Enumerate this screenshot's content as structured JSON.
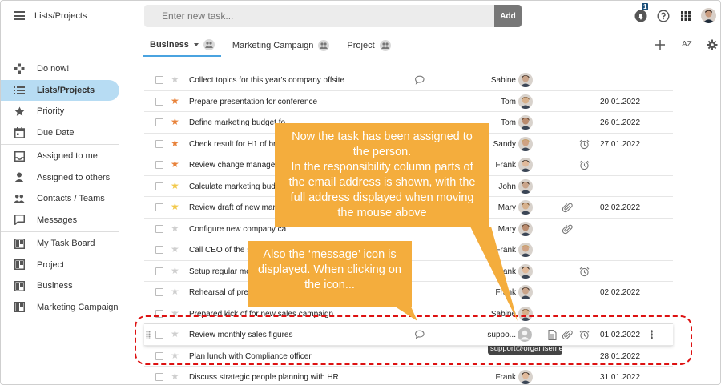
{
  "header": {
    "title": "Lists/Projects",
    "task_placeholder": "Enter new task...",
    "add_label": "Add",
    "notification_count": "1"
  },
  "tabs": [
    {
      "label": "Business",
      "active": true
    },
    {
      "label": "Marketing Campaign"
    },
    {
      "label": "Project"
    }
  ],
  "sort_label": "AZ",
  "sidebar": {
    "items": [
      {
        "label": "Do now!",
        "icon": "gamepad-icon"
      },
      {
        "label": "Lists/Projects",
        "icon": "list-icon",
        "active": true
      },
      {
        "label": "Priority",
        "icon": "star-icon"
      },
      {
        "label": "Due Date",
        "icon": "calendar-icon"
      },
      {
        "label": "Assigned to me",
        "icon": "inbox-icon"
      },
      {
        "label": "Assigned to others",
        "icon": "person-icon"
      },
      {
        "label": "Contacts / Teams",
        "icon": "people-icon"
      },
      {
        "label": "Messages",
        "icon": "message-icon"
      },
      {
        "label": "My Task Board",
        "icon": "board-icon"
      },
      {
        "label": "Project",
        "icon": "board-icon"
      },
      {
        "label": "Business",
        "icon": "board-icon"
      },
      {
        "label": "Marketing Campaign",
        "icon": "board-icon"
      }
    ]
  },
  "tasks": [
    {
      "title": "Collect topics for this year's company offsite",
      "star": "none",
      "responsible": "Sabine",
      "due": "",
      "message": true
    },
    {
      "title": "Prepare presentation for conference",
      "star": "orange",
      "responsible": "Tom",
      "due": "20.01.2022"
    },
    {
      "title": "Define marketing budget fo",
      "star": "orange",
      "responsible": "Tom",
      "due": "26.01.2022"
    },
    {
      "title": "Check result for H1 of branc",
      "star": "orange",
      "responsible": "Sandy",
      "due": "27.01.2022",
      "alarm": true
    },
    {
      "title": "Review change manageme",
      "star": "orange",
      "responsible": "Frank",
      "due": "",
      "alarm": true
    },
    {
      "title": "Calculate marketing budget",
      "star": "yellow",
      "responsible": "John",
      "due": ""
    },
    {
      "title": "Review draft of new market",
      "star": "yellow",
      "responsible": "Mary",
      "due": "02.02.2022",
      "attachment": true
    },
    {
      "title": "Configure new company ca",
      "star": "none",
      "responsible": "Mary",
      "due": "",
      "attachment": true
    },
    {
      "title": "Call CEO of the st",
      "star": "none",
      "responsible": "Frank",
      "due": ""
    },
    {
      "title": "Setup regular meet",
      "star": "none",
      "responsible": "Frank",
      "due": "",
      "alarm": true
    },
    {
      "title": "Rehearsal of prese",
      "star": "none",
      "responsible": "Frank",
      "due": "02.02.2022"
    },
    {
      "title": "Prepared kick of for new sales campaign",
      "star": "none",
      "responsible": "Sabine",
      "due": ""
    },
    {
      "title": "Review monthly sales figures",
      "star": "none",
      "responsible": "suppo...",
      "due": "01.02.2022",
      "message": true,
      "note": true,
      "attachment": true,
      "alarm": true,
      "highlight": true
    },
    {
      "title": "Plan lunch with Compliance officer",
      "star": "none",
      "responsible": "",
      "due": "28.01.2022"
    },
    {
      "title": "Discuss strategic people planning with HR",
      "star": "none",
      "responsible": "Frank",
      "due": "31.01.2022"
    }
  ],
  "tooltip": "support@organiseme.com",
  "callouts": {
    "assigned": "Now the task has been assigned to the person.\nIn the responsibility column parts of the email address is shown, with the full address displayed when moving the mouse above",
    "message": "Also the ‘message’ icon is displayed. When clicking on the icon..."
  },
  "colors": {
    "accent": "#4aa3e0",
    "sidebar_active": "#b7dcf3",
    "callout": "#f4ad3d",
    "star_orange": "#e8823a",
    "star_yellow": "#f2c94c",
    "star_none": "#cfcfcf",
    "highlight": "#d11111"
  }
}
